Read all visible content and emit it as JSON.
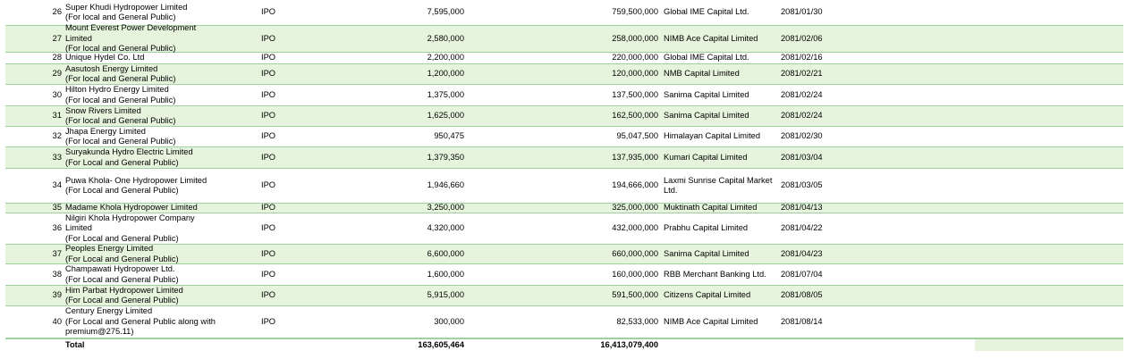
{
  "rows": [
    {
      "sn": "26",
      "name_lines": [
        "Super Khudi Hydropower Limited",
        "(For local and General Public)"
      ],
      "type": "IPO",
      "units": "7,595,000",
      "amount": "759,500,000",
      "manager": "Global IME Capital Ltd.",
      "date": "2081/01/30"
    },
    {
      "sn": "27",
      "name_lines": [
        "Mount Everest Power Development",
        "Limited",
        "(For local and General Public)"
      ],
      "type": "IPO",
      "units": "2,580,000",
      "amount": "258,000,000",
      "manager": "NIMB Ace Capital Limited",
      "date": "2081/02/06"
    },
    {
      "sn": "28",
      "name_lines": [
        "Unique Hydel Co. Ltd"
      ],
      "type": "IPO",
      "units": "2,200,000",
      "amount": "220,000,000",
      "manager": "Global IME Capital Ltd.",
      "date": "2081/02/16"
    },
    {
      "sn": "29",
      "name_lines": [
        "Aasutosh Energy Limited",
        "(For local and General Public)"
      ],
      "type": "IPO",
      "units": "1,200,000",
      "amount": "120,000,000",
      "manager": "NMB Capital Limited",
      "date": "2081/02/21"
    },
    {
      "sn": "30",
      "name_lines": [
        "Hilton Hydro Energy Limited",
        "(For local and General Public)"
      ],
      "type": "IPO",
      "units": "1,375,000",
      "amount": "137,500,000",
      "manager": "Sanima Capital Limited",
      "date": "2081/02/24"
    },
    {
      "sn": "31",
      "name_lines": [
        "Snow Rivers Limited",
        "(For local and General Public)"
      ],
      "type": "IPO",
      "units": "1,625,000",
      "amount": "162,500,000",
      "manager": "Sanima Capital Limited",
      "date": "2081/02/24"
    },
    {
      "sn": "32",
      "name_lines": [
        "Jhapa Energy Limited",
        "(For local and General Public)"
      ],
      "type": "IPO",
      "units": "950,475",
      "amount": "95,047,500",
      "manager": "Himalayan Capital Limited",
      "date": "2081/02/30"
    },
    {
      "sn": "33",
      "name_lines": [
        "Suryakunda Hydro Electric Limited",
        "(For Local and General Public)"
      ],
      "type": "IPO",
      "units": "1,379,350",
      "amount": "137,935,000",
      "manager": "Kumari Capital Limited",
      "date": "2081/03/04"
    },
    {
      "sn": "34",
      "name_lines": [
        "Puwa Khola- One Hydropower Limited",
        "(For Local and General Public)"
      ],
      "type": "IPO",
      "units": "1,946,660",
      "amount": "194,666,000",
      "manager": "Laxmi Sunrise Capital Market Ltd.",
      "date": "2081/03/05"
    },
    {
      "sn": "35",
      "name_lines": [
        "Madame Khola Hydropower Limited"
      ],
      "type": "IPO",
      "units": "3,250,000",
      "amount": "325,000,000",
      "manager": "Muktinath Capital Limited",
      "date": "2081/04/13"
    },
    {
      "sn": "36",
      "name_lines": [
        "Nilgiri Khola Hydropower Company",
        "Limited",
        "(For Local and General Public)"
      ],
      "type": "IPO",
      "units": "4,320,000",
      "amount": "432,000,000",
      "manager": "Prabhu Capital Limited",
      "date": "2081/04/22"
    },
    {
      "sn": "37",
      "name_lines": [
        "Peoples Energy Limited",
        "(For Local and General Public)"
      ],
      "type": "IPO",
      "units": "6,600,000",
      "amount": "660,000,000",
      "manager": "Sanima Capital Limited",
      "date": "2081/04/23"
    },
    {
      "sn": "38",
      "name_lines": [
        "Champawati Hydropower Ltd.",
        "(For Local and General Public)"
      ],
      "type": "IPO",
      "units": "1,600,000",
      "amount": "160,000,000",
      "manager": "RBB Merchant Banking Ltd.",
      "date": "2081/07/04"
    },
    {
      "sn": "39",
      "name_lines": [
        "Him Parbat Hydropower Limited",
        "(For Local and General Public)"
      ],
      "type": "IPO",
      "units": "5,915,000",
      "amount": "591,500,000",
      "manager": "Citizens Capital Limited",
      "date": "2081/08/05"
    },
    {
      "sn": "40",
      "name_lines": [
        "Century Energy Limited",
        "(For Local and General Public along with",
        "premium@275.11)"
      ],
      "type": "IPO",
      "units": "300,000",
      "amount": "82,533,000",
      "manager": "NIMB Ace Capital Limited",
      "date": "2081/08/14"
    }
  ],
  "total": {
    "label": "Total",
    "units": "163,605,464",
    "amount": "16,413,079,400"
  },
  "colors": {
    "row_alt": "#e6f4dd",
    "border": "#9fd19f"
  }
}
